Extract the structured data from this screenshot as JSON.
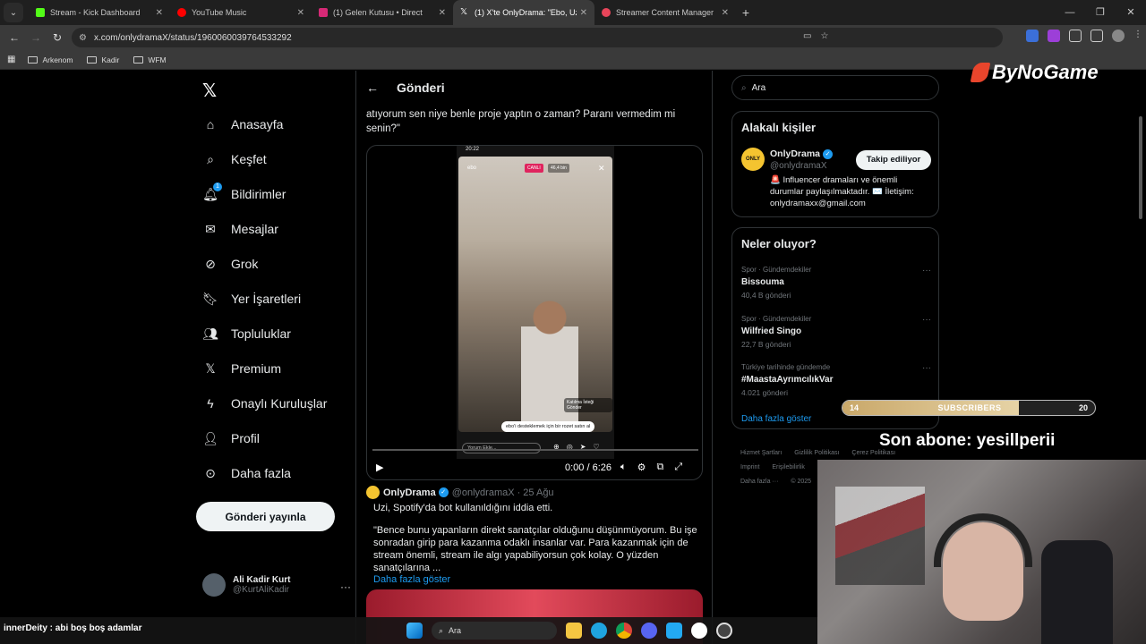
{
  "browser": {
    "tabs": [
      {
        "title": "Stream - Kick Dashboard",
        "color": "#53fc18"
      },
      {
        "title": "YouTube Music",
        "color": "#ff0000"
      },
      {
        "title": "(1) Gelen Kutusu • Direct",
        "color": "#d62976"
      },
      {
        "title": "(1) X'te OnlyDrama: \"Ebo, Uzi'ni",
        "color": "#ffffff",
        "active": true
      },
      {
        "title": "Streamer Content Manager",
        "color": "#e8455a"
      }
    ],
    "url": "x.com/onlydramaX/status/1960060039764533292",
    "bookmarks": [
      "Arkenom",
      "Kadir",
      "WFM"
    ]
  },
  "nav": {
    "items": [
      {
        "label": "Anasayfa",
        "icon": "home-icon"
      },
      {
        "label": "Keşfet",
        "icon": "search-icon"
      },
      {
        "label": "Bildirimler",
        "icon": "bell-icon",
        "badge": "1"
      },
      {
        "label": "Mesajlar",
        "icon": "mail-icon"
      },
      {
        "label": "Grok",
        "icon": "grok-icon"
      },
      {
        "label": "Yer İşaretleri",
        "icon": "bookmark-icon"
      },
      {
        "label": "Topluluklar",
        "icon": "communities-icon"
      },
      {
        "label": "Premium",
        "icon": "x-icon"
      },
      {
        "label": "Onaylı Kuruluşlar",
        "icon": "lightning-icon"
      },
      {
        "label": "Profil",
        "icon": "person-icon"
      },
      {
        "label": "Daha fazla",
        "icon": "more-icon"
      }
    ],
    "post_button": "Gönderi yayınla",
    "account_name": "Ali Kadir Kurt",
    "account_handle": "@KurtAliKadir"
  },
  "post": {
    "header": "Gönderi",
    "text": "atıyorum sen niye benle proje yaptın o zaman? Paranı vermedim mi senin?\"",
    "phone": {
      "clock": "20:22",
      "live": "CANLI",
      "viewers": "46,4 bin",
      "username": "ebo",
      "join_request": "Katılma İsteği Gönder",
      "bot_message": "ebo'i desteklemek için bir rozet satın al",
      "comment_placeholder": "Yorum Ekle..."
    },
    "video_time": "0:00 / 6:26"
  },
  "quote": {
    "name": "OnlyDrama",
    "handle": "@onlydramaX",
    "date": "· 25 Ağu",
    "line1": "Uzi, Spotify'da bot kullanıldığını iddia etti.",
    "body": "\"Bence bunu yapanların direkt sanatçılar olduğunu düşünmüyorum. Bu işe sonradan girip para kazanma odaklı insanlar var. Para kazanmak için de stream önemli, stream ile algı yapabiliyorsun çok kolay. O yüzden sanatçılarına ...",
    "more": "Daha fazla göster"
  },
  "sidebar": {
    "search_value": "Ara",
    "related_title": "Alakalı kişiler",
    "person_name": "OnlyDrama",
    "person_handle": "@onlydramaX",
    "follow_label": "Takip ediliyor",
    "person_bio": "🚨 Influencer dramaları ve önemli durumlar paylaşılmaktadır. ✉️ İletişim: onlydramaxx@gmail.com",
    "trends_title": "Neler oluyor?",
    "trends": [
      {
        "category": "Spor · Gündemdekiler",
        "name": "Bissouma",
        "count": "40,4 B gönderi"
      },
      {
        "category": "Spor · Gündemdekiler",
        "name": "Wilfried Singo",
        "count": "22,7 B gönderi"
      },
      {
        "category": "Türkiye tarihinde gündemde",
        "name": "#MaastaAyrımcılıkVar",
        "count": "4.021 gönderi"
      }
    ],
    "show_more": "Daha fazla göster",
    "footer": [
      "Hizmet Şartları",
      "Gizlilik Politikası",
      "Çerez Politikası",
      "Imprint",
      "Erişilebilirlik",
      "Daha fazla ···",
      "© 2025"
    ]
  },
  "overlay": {
    "brand": "ByNoGame",
    "subs_current": "14",
    "subs_label": "SUBSCRIBERS",
    "subs_goal": "20",
    "subs_progress": 0.7,
    "last_sub": "Son abone: yesillperii",
    "chat_user": "innerDeity",
    "chat_message": "abi boş boş adamlar",
    "taskbar_search": "Ara"
  }
}
